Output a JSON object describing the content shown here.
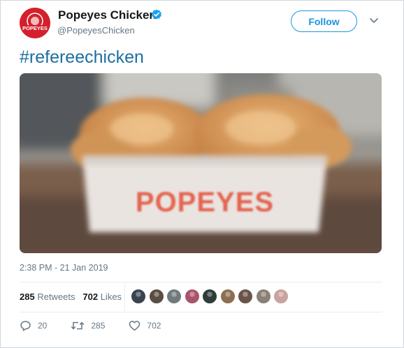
{
  "tweet": {
    "author": {
      "display_name": "Popeyes Chicken",
      "handle": "@PopeyesChicken",
      "avatar_text": "POPEYES",
      "verified": true
    },
    "follow_label": "Follow",
    "hashtag": "#refereechicken",
    "image": {
      "box_text": "POPEYES"
    },
    "timestamp": "2:38 PM - 21 Jan 2019",
    "stats": {
      "retweets_count": "285",
      "retweets_label": "Retweets",
      "likes_count": "702",
      "likes_label": "Likes"
    },
    "likers": [
      {
        "icon": "liker-avatar",
        "color": "#3b4350"
      },
      {
        "icon": "liker-avatar",
        "color": "#5a4d42"
      },
      {
        "icon": "liker-avatar",
        "color": "#6f7a7c"
      },
      {
        "icon": "liker-avatar",
        "color": "#a8556b"
      },
      {
        "icon": "liker-avatar",
        "color": "#2f3c39"
      },
      {
        "icon": "liker-avatar",
        "color": "#8c6f52"
      },
      {
        "icon": "liker-avatar",
        "color": "#6a5448"
      },
      {
        "icon": "liker-avatar",
        "color": "#8a8077"
      },
      {
        "icon": "liker-avatar",
        "color": "#c9a39d"
      }
    ],
    "actions": {
      "reply_count": "20",
      "retweet_count": "285",
      "like_count": "702"
    },
    "colors": {
      "accent": "#1b95e0",
      "hashtag": "#1b6fa0",
      "brand_red": "#d4202d",
      "muted_text": "#657786"
    }
  }
}
